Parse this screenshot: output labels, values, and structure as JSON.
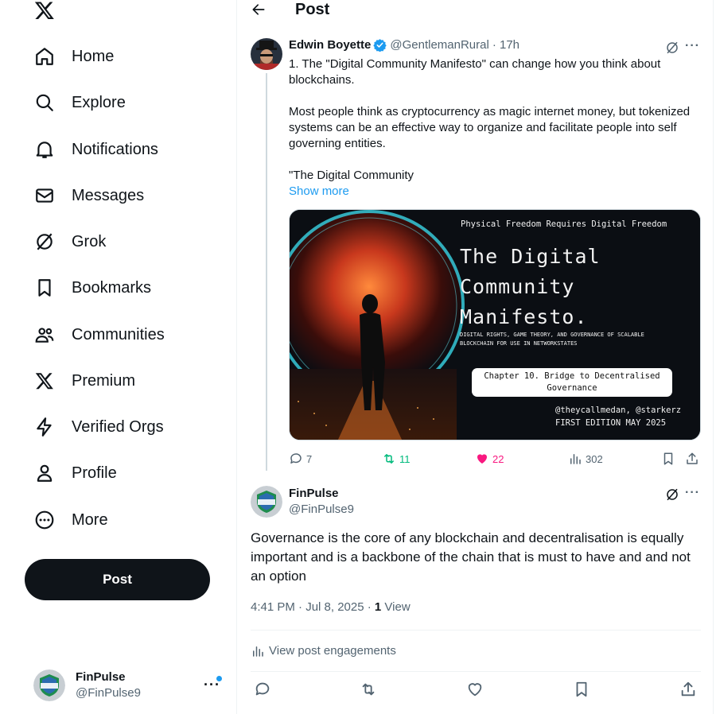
{
  "nav": {
    "items": [
      {
        "label": "Home",
        "icon": "home-icon"
      },
      {
        "label": "Explore",
        "icon": "search-icon"
      },
      {
        "label": "Notifications",
        "icon": "bell-icon"
      },
      {
        "label": "Messages",
        "icon": "envelope-icon"
      },
      {
        "label": "Grok",
        "icon": "grok-icon"
      },
      {
        "label": "Bookmarks",
        "icon": "bookmark-icon"
      },
      {
        "label": "Communities",
        "icon": "communities-icon"
      },
      {
        "label": "Premium",
        "icon": "x-logo-icon"
      },
      {
        "label": "Verified Orgs",
        "icon": "lightning-icon"
      },
      {
        "label": "Profile",
        "icon": "person-icon"
      },
      {
        "label": "More",
        "icon": "more-circle-icon"
      }
    ],
    "post_button": "Post",
    "account": {
      "name": "FinPulse",
      "handle": "@FinPulse9"
    }
  },
  "header": {
    "title": "Post"
  },
  "tweet1": {
    "name": "Edwin Boyette",
    "handle": "@GentlemanRural",
    "time": "· 17h",
    "text": [
      "1. The \"Digital Community Manifesto\" can change how you think about blockchains.",
      "Most people think as cryptocurrency as magic internet money, but tokenized systems can be an effective way to organize and facilitate people into self governing entities.",
      "\"The Digital Community"
    ],
    "show_more": "Show more",
    "media": {
      "top_line": "Physical Freedom Requires Digital Freedom",
      "title_lines": [
        "The Digital",
        "Community",
        "Manifesto."
      ],
      "subtitle_lines": [
        "DIGITAL RIGHTS, GAME THEORY, AND GOVERNANCE OF SCALABLE",
        "BLOCKCHAIN FOR USE IN NETWORKSTATES"
      ],
      "chapter_lines": [
        "Chapter 10. Bridge to Decentralised",
        "Governance"
      ],
      "credit": "@theycallmedan, @starkerz",
      "edition": "FIRST EDITION MAY 2025"
    },
    "actions": {
      "replies": "7",
      "reposts": "11",
      "likes": "22",
      "views": "302"
    }
  },
  "tweet2": {
    "name": "FinPulse",
    "handle": "@FinPulse9",
    "text": "Governance is the core of any blockchain and decentralisation is equally important and is a backbone of the chain that is must to have and and not an option",
    "time": "4:41 PM · Jul 8, 2025 · ",
    "views_count": "1",
    "views_label": " View",
    "engagements": "View post engagements"
  },
  "colors": {
    "accent": "#1d9bf0",
    "repost": "#00ba7c",
    "like": "#f91880",
    "text": "#0f1419",
    "muted": "#536471"
  }
}
